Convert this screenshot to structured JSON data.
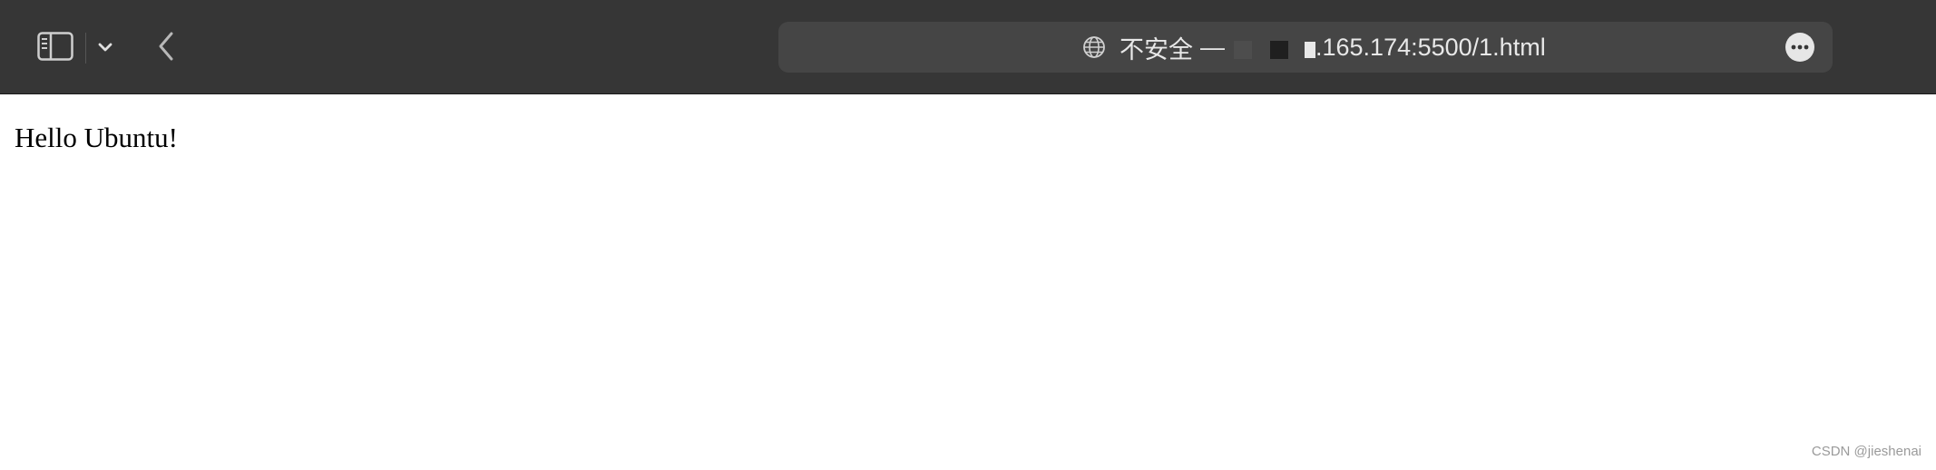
{
  "browser": {
    "address_bar": {
      "security_label": "不安全",
      "separator": "—",
      "url_visible": ".165.174:5500/1.html"
    },
    "icons": {
      "sidebar": "sidebar-icon",
      "chevron": "chevron-down-icon",
      "back": "back-arrow-icon",
      "globe": "globe-icon",
      "more": "more-icon"
    },
    "colors": {
      "toolbar_bg": "#363636",
      "address_bg": "#454545",
      "toolbar_fg": "#e8e8e8"
    }
  },
  "page": {
    "content": "Hello Ubuntu!",
    "watermark": "CSDN @jieshenai"
  }
}
